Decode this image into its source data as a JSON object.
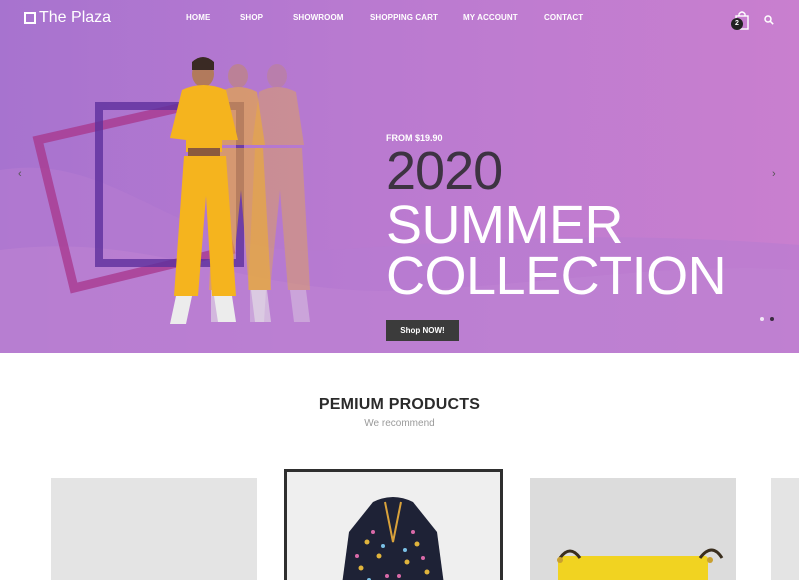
{
  "brand": {
    "name": "The Plaza",
    "accent": "#3b3b3b",
    "hero_gradient": [
      "#a773cf",
      "#c97fcf"
    ]
  },
  "nav": {
    "items": [
      {
        "label": "HOME"
      },
      {
        "label": "SHOP"
      },
      {
        "label": "SHOWROOM"
      },
      {
        "label": "SHOPPING CART"
      },
      {
        "label": "MY ACCOUNT"
      },
      {
        "label": "CONTACT"
      }
    ]
  },
  "cart": {
    "count": "2",
    "icon": "shopping-bag-icon"
  },
  "search": {
    "icon": "search-icon"
  },
  "hero": {
    "from": "FROM $19.90",
    "year": "2020",
    "line1": "SUMMER",
    "line2": "COLLECTION",
    "cta": "Shop NOW!",
    "prev_icon": "‹",
    "next_icon": "›",
    "slides": 2,
    "active_slide": 2
  },
  "section": {
    "title": "PEMIUM PRODUCTS",
    "subtitle": "We recommend"
  }
}
